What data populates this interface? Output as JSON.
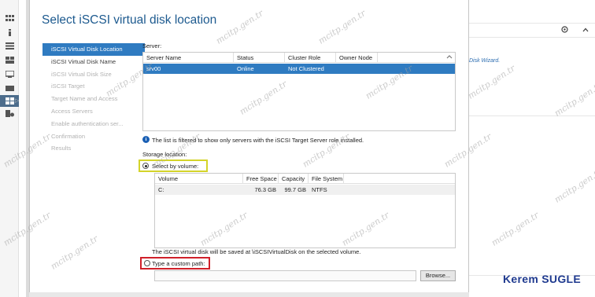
{
  "wizard": {
    "title": "Select iSCSI virtual disk location",
    "steps": [
      {
        "label": "iSCSI Virtual Disk Location",
        "state": "active"
      },
      {
        "label": "iSCSI Virtual Disk Name",
        "state": "normal"
      },
      {
        "label": "iSCSI Virtual Disk Size",
        "state": "disabled"
      },
      {
        "label": "iSCSI Target",
        "state": "disabled"
      },
      {
        "label": "Target Name and Access",
        "state": "disabled"
      },
      {
        "label": "Access Servers",
        "state": "disabled"
      },
      {
        "label": "Enable authentication ser...",
        "state": "disabled"
      },
      {
        "label": "Confirmation",
        "state": "disabled"
      },
      {
        "label": "Results",
        "state": "disabled"
      }
    ]
  },
  "server_section": {
    "label": "Server:",
    "columns": [
      "Server Name",
      "Status",
      "Cluster Role",
      "Owner Node"
    ],
    "rows": [
      {
        "server_name": "srv00",
        "status": "Online",
        "cluster_role": "Not Clustered",
        "owner_node": ""
      }
    ],
    "info_text": "The list is filtered to show only servers with the iSCSI Target Server role installed."
  },
  "storage_section": {
    "label": "Storage location:",
    "select_by_volume_label": "Select by volume:",
    "select_by_volume_checked": true,
    "columns": [
      "Volume",
      "Free Space",
      "Capacity",
      "File System"
    ],
    "rows": [
      {
        "volume": "C:",
        "free_space": "76.3 GB",
        "capacity": "99.7 GB",
        "file_system": "NTFS"
      }
    ],
    "save_note": "The iSCSI virtual disk will be saved at \\iSCSIVirtualDisk on the selected volume.",
    "custom_path_label": "Type a custom path:",
    "custom_path_checked": false,
    "custom_path_value": "",
    "browse_label": "Browse..."
  },
  "host": {
    "right_link_text": "Disk Wizard.",
    "author": "Kerem SUGLE",
    "watermark": "mcitp.gen.tr"
  },
  "colors": {
    "accent": "#2f7bc1",
    "title": "#1d5a8f",
    "highlight_yellow": "#d4d42a",
    "highlight_red": "#d0202a",
    "author": "#1f3a8f"
  }
}
